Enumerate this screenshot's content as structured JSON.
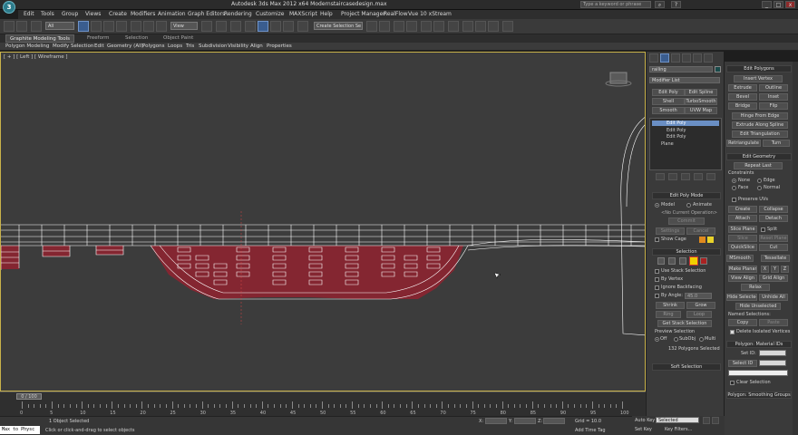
{
  "window": {
    "title": "Autodesk 3ds Max  2012 x64     Modernstaircasedesign.max",
    "search_placeholder": "Type a keyword or phrase",
    "min": "_",
    "max": "□",
    "close": "x"
  },
  "menu": [
    "Edit",
    "Tools",
    "Group",
    "Views",
    "Create",
    "Modifiers",
    "Animation",
    "Graph Editors",
    "Rendering",
    "Customize",
    "MAXScript",
    "Help",
    "Project Manager",
    "RealFlow",
    "Vue 10 xStream"
  ],
  "toolbar": {
    "selection_filter": "All",
    "view_dropdown": "View",
    "named_selection": "Create Selection Se"
  },
  "ribbon": {
    "tabs": [
      "Graphite Modeling Tools",
      "Freeform",
      "Selection",
      "Object Paint"
    ],
    "items": [
      "Polygon Modeling",
      "Modify Selection",
      "Edit",
      "Geometry (All)",
      "Polygons",
      "Loops",
      "Tris",
      "Subdivision",
      "Visibility",
      "Align",
      "Properties"
    ]
  },
  "viewport": {
    "label": "[ + ] [ Left ] [ Wireframe ]"
  },
  "command_panel": {
    "object_name": "railing",
    "modifier_list": "Modifier List",
    "mod_buttons": [
      "Edit Poly",
      "Edit Spline",
      "Shell",
      "TurboSmooth",
      "Smooth",
      "UVW Map"
    ],
    "stack": [
      "Edit Poly",
      "Edit Poly",
      "Edit Poly",
      "Plane"
    ],
    "edit_poly_mode": {
      "header": "Edit Poly Mode",
      "model": "Model",
      "animate": "Animate",
      "no_op": "<No Current Operation>",
      "commit": "Commit",
      "settings": "Settings",
      "cancel": "Cancel",
      "show_cage": "Show Cage"
    },
    "selection": {
      "header": "Selection",
      "use_stack": "Use Stack Selection",
      "by_vertex": "By Vertex",
      "ignore_backfacing": "Ignore Backfacing",
      "by_angle": "By Angle:",
      "angle_value": "45.0",
      "shrink": "Shrink",
      "grow": "Grow",
      "ring": "Ring",
      "loop": "Loop",
      "get_stack": "Get Stack Selection",
      "preview": "Preview Selection",
      "preview_off": "Off",
      "preview_subobj": "SubObj",
      "preview_multi": "Multi",
      "status": "132 Polygons Selected"
    },
    "soft_selection": "Soft Selection"
  },
  "right_panel": {
    "edit_polygons": {
      "header": "Edit Polygons",
      "insert_vertex": "Insert Vertex",
      "extrude": "Extrude",
      "outline": "Outline",
      "bevel": "Bevel",
      "inset": "Inset",
      "bridge": "Bridge",
      "flip": "Flip",
      "hinge": "Hinge From Edge",
      "extrude_spline": "Extrude Along Spline",
      "edit_tri": "Edit Triangulation",
      "retriangulate": "Retriangulate",
      "turn": "Turn"
    },
    "edit_geometry": {
      "header": "Edit Geometry",
      "repeat_last": "Repeat Last",
      "constraints": "Constraints",
      "none": "None",
      "edge": "Edge",
      "face": "Face",
      "normal": "Normal",
      "preserve_uvs": "Preserve UVs",
      "create": "Create",
      "collapse": "Collapse",
      "attach": "Attach",
      "detach": "Detach",
      "slice_plane": "Slice Plane",
      "split": "Split",
      "slice": "Slice",
      "reset_plane": "Reset Plane",
      "quickslice": "QuickSlice",
      "cut": "Cut",
      "msmooth": "MSmooth",
      "tessellate": "Tessellate",
      "make_planar": "Make Planar",
      "x": "X",
      "y": "Y",
      "z": "Z",
      "view_align": "View Align",
      "grid_align": "Grid Align",
      "relax": "Relax",
      "hide_selected": "Hide Selected",
      "unhide_all": "Unhide All",
      "hide_unselected": "Hide Unselected",
      "named_selections": "Named Selections:",
      "copy": "Copy",
      "paste": "Paste",
      "delete_isolated": "Delete Isolated Vertices"
    },
    "material_ids": {
      "header": "Polygon: Material IDs",
      "set_id": "Set ID:",
      "select_id": "Select ID",
      "clear_selection": "Clear Selection"
    },
    "smoothing": {
      "header": "Polygon: Smoothing Groups"
    }
  },
  "timeline": {
    "frame": "0 / 100",
    "ticks": [
      "0",
      "5",
      "10",
      "15",
      "20",
      "25",
      "30",
      "35",
      "40",
      "45",
      "50",
      "55",
      "60",
      "65",
      "70",
      "75",
      "80",
      "85",
      "90",
      "95",
      "100"
    ]
  },
  "status": {
    "maxscript": "Max to Physc",
    "objects_selected": "1 Object Selected",
    "prompt": "Click or click-and-drag to select objects",
    "x_label": "X:",
    "y_label": "Y:",
    "z_label": "Z:",
    "grid": "Grid = 10.0",
    "add_time_tag": "Add Time Tag",
    "auto_key": "Auto Key",
    "set_key": "Set Key",
    "key_filter": "Selected",
    "key_filters": "Key Filters..."
  }
}
